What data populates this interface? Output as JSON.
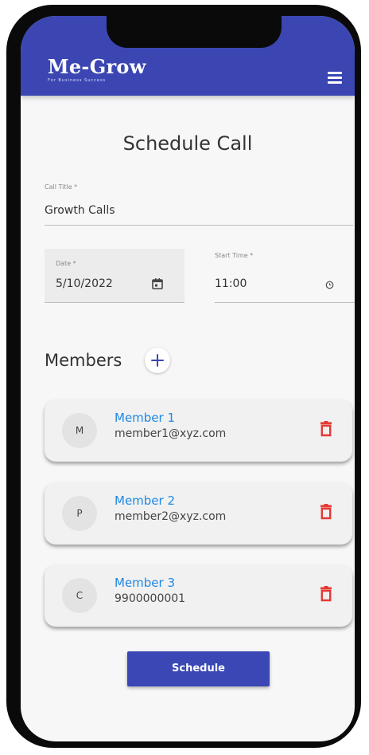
{
  "header": {
    "logo_title": "Me-Grow",
    "logo_tagline": "For Business Success",
    "menu_icon": "hamburger-menu-icon",
    "background_color": "#3b46b2"
  },
  "page": {
    "title": "Schedule Call"
  },
  "form": {
    "call_title": {
      "label": "Call Title *",
      "value": "Growth Calls"
    },
    "date": {
      "label": "Date *",
      "value": "5/10/2022",
      "icon": "calendar-icon"
    },
    "start_time": {
      "label": "Start Time *",
      "value": "11:00",
      "icon": "clock-icon"
    }
  },
  "members": {
    "title": "Members",
    "add_icon": "plus-icon",
    "delete_icon": "trash-icon",
    "accent_color": "#1e88e5",
    "delete_color": "#e53935",
    "items": [
      {
        "initial": "M",
        "name": "Member 1",
        "detail": "member1@xyz.com"
      },
      {
        "initial": "P",
        "name": "Member 2",
        "detail": "member2@xyz.com"
      },
      {
        "initial": "C",
        "name": "Member 3",
        "detail": "9900000001"
      }
    ]
  },
  "actions": {
    "schedule_label": "Schedule",
    "button_color": "#3a47b5"
  }
}
